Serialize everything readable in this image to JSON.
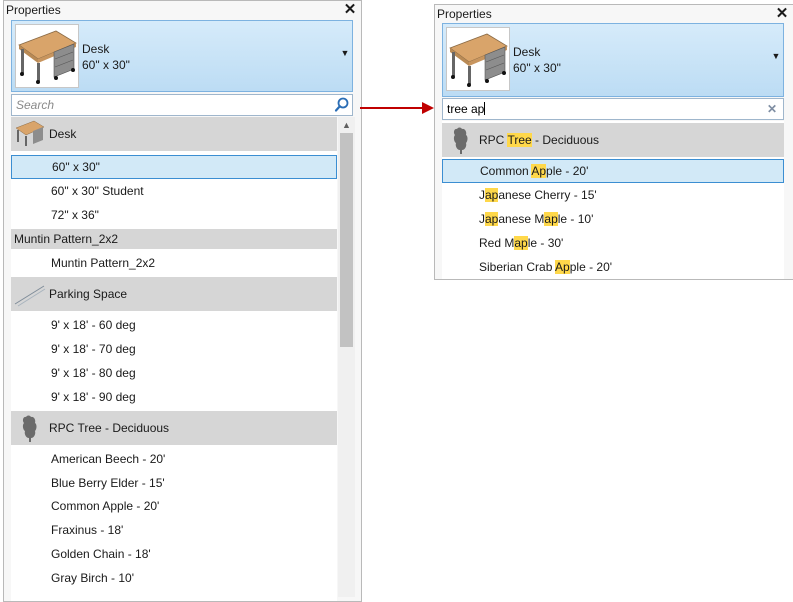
{
  "colors": {
    "accent": "#3b8ed2",
    "family_row_bg": "#d6d6d6",
    "highlight": "#ffd84a",
    "arrow": "#c00000"
  },
  "left_panel": {
    "title": "Properties",
    "close_icon": "close-icon",
    "type_selector": {
      "family": "Desk",
      "size": "60\" x 30\""
    },
    "search": {
      "placeholder": "Search",
      "value": ""
    },
    "list": {
      "family_desk": "Desk",
      "desk_60x30": "60\" x 30\"",
      "desk_60x30_student": "60\" x 30\" Student",
      "desk_72x36": "72\" x 36\"",
      "family_muntin": "Muntin Pattern_2x2",
      "muntin_item": "Muntin Pattern_2x2",
      "family_parking": "Parking Space",
      "parking_60": "9' x 18' - 60 deg",
      "parking_70": "9' x 18' - 70 deg",
      "parking_80": "9' x 18' - 80 deg",
      "parking_90": "9' x 18' - 90 deg",
      "family_tree": "RPC Tree - Deciduous",
      "tree_beech": "American Beech - 20'",
      "tree_blueberry": "Blue Berry Elder - 15'",
      "tree_apple": "Common Apple - 20'",
      "tree_fraxinus": "Fraxinus - 18'",
      "tree_golden_chain": "Golden Chain - 18'",
      "tree_gray_birch": "Gray Birch - 10'"
    }
  },
  "right_panel": {
    "title": "Properties",
    "type_selector": {
      "family": "Desk",
      "size": "60\" x 30\""
    },
    "search": {
      "value": "tree ap"
    },
    "family": {
      "pre": "RPC ",
      "hl": "Tree",
      "post": " - Deciduous"
    },
    "results": [
      {
        "pre": "Common ",
        "hl": "Ap",
        "post": "ple - 20'"
      },
      {
        "pre": "J",
        "hl": "ap",
        "post": "anese Cherry - 15'"
      },
      {
        "pre": "J",
        "hl": "ap",
        "post": "anese M",
        "hl2": "ap",
        "post2": "le - 10'"
      },
      {
        "pre": "Red M",
        "hl": "ap",
        "post": "le - 30'"
      },
      {
        "pre": "Siberian Crab ",
        "hl": "Ap",
        "post": "ple - 20'"
      }
    ]
  }
}
